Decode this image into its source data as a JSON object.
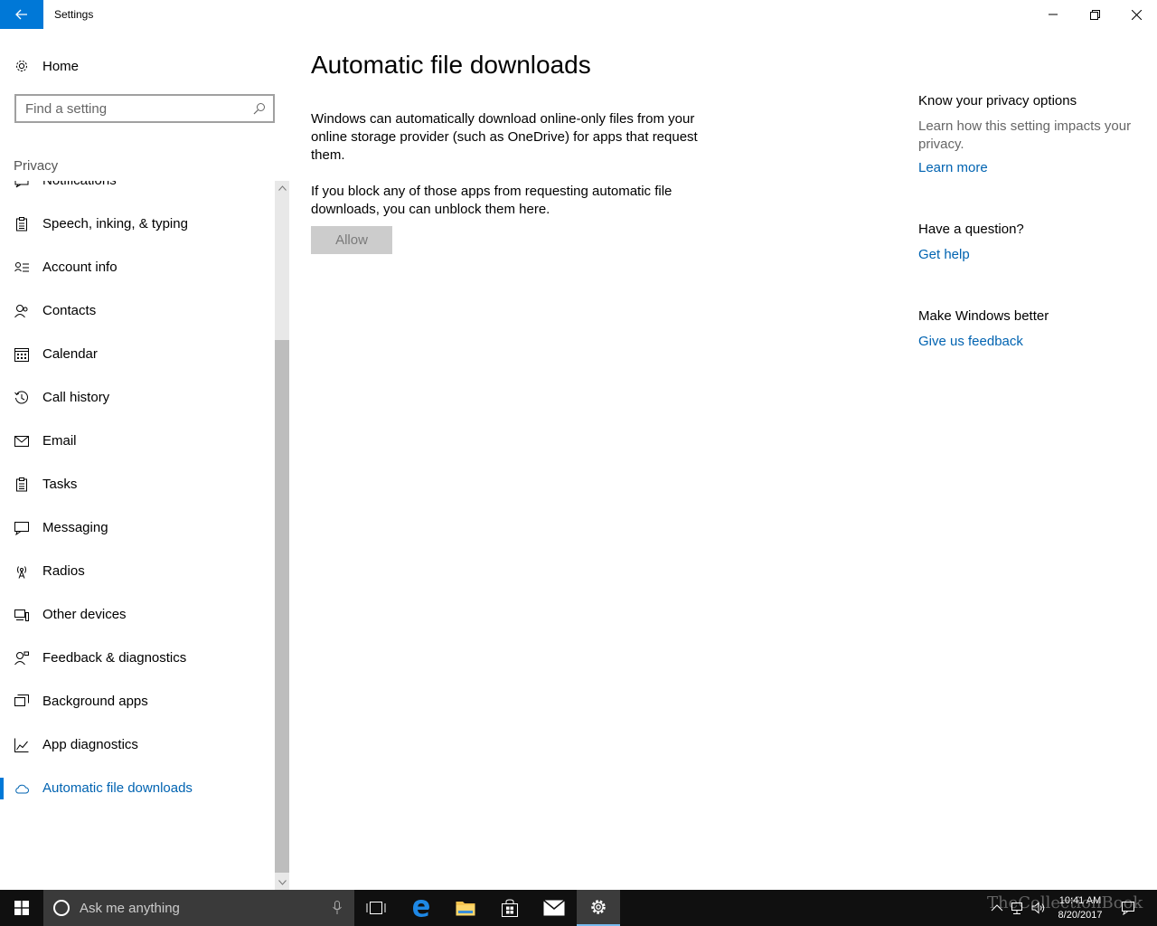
{
  "window": {
    "title": "Settings"
  },
  "sidebar": {
    "home_label": "Home",
    "search_placeholder": "Find a setting",
    "section_label": "Privacy",
    "items": [
      {
        "label": "Notifications",
        "icon": "notifications-icon"
      },
      {
        "label": "Speech, inking, & typing",
        "icon": "clipboard-icon"
      },
      {
        "label": "Account info",
        "icon": "account-info-icon"
      },
      {
        "label": "Contacts",
        "icon": "contacts-icon"
      },
      {
        "label": "Calendar",
        "icon": "calendar-icon"
      },
      {
        "label": "Call history",
        "icon": "history-icon"
      },
      {
        "label": "Email",
        "icon": "mail-icon"
      },
      {
        "label": "Tasks",
        "icon": "tasks-icon"
      },
      {
        "label": "Messaging",
        "icon": "chat-icon"
      },
      {
        "label": "Radios",
        "icon": "radio-tower-icon"
      },
      {
        "label": "Other devices",
        "icon": "devices-icon"
      },
      {
        "label": "Feedback & diagnostics",
        "icon": "feedback-icon"
      },
      {
        "label": "Background apps",
        "icon": "background-apps-icon"
      },
      {
        "label": "App diagnostics",
        "icon": "chart-icon"
      },
      {
        "label": "Automatic file downloads",
        "icon": "cloud-icon",
        "active": true
      }
    ]
  },
  "main": {
    "title": "Automatic file downloads",
    "paragraph1": "Windows can automatically download online-only files from your online storage provider (such as OneDrive) for apps that request them.",
    "paragraph2": "If you block any of those apps from requesting automatic file downloads, you can unblock them here.",
    "allow_button": "Allow"
  },
  "aside": {
    "privacy_heading": "Know your privacy options",
    "privacy_text": "Learn how this setting impacts your privacy.",
    "learn_more": "Learn more",
    "question_heading": "Have a question?",
    "get_help": "Get help",
    "better_heading": "Make Windows better",
    "feedback_link": "Give us feedback"
  },
  "taskbar": {
    "search_placeholder": "Ask me anything",
    "time": "10:41 AM",
    "date": "8/20/2017",
    "watermark": "TheCollectionBook"
  },
  "colors": {
    "accent": "#0078d7",
    "link": "#0063b1",
    "taskbar": "#101010"
  }
}
